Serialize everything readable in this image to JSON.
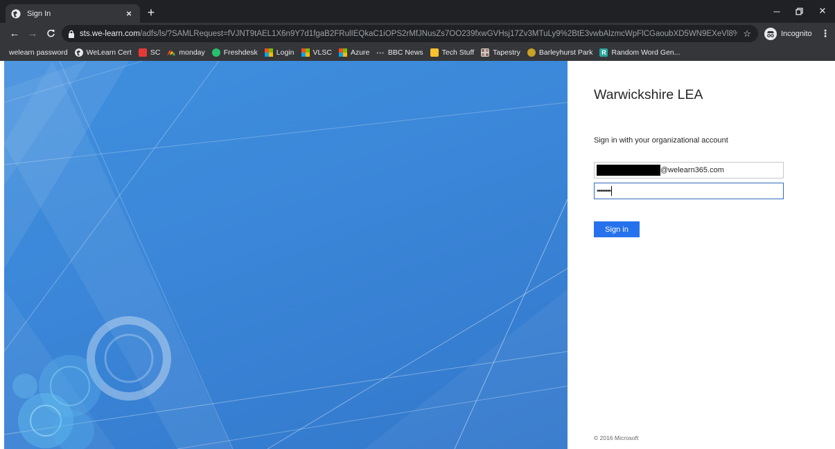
{
  "browser": {
    "tab_title": "Sign In",
    "url_host": "sts.we-learn.com",
    "url_path": "/adfs/ls/?SAMLRequest=fVJNT9tAEL1X6n9Y7d1fgaB2FRulIEQkaC1iOPS2rMfJNusZs7OO239fxwGVHsj17Zv3MTuLy9%2BtE3vwbAlzmcWpFlCGaoubXD5WN9EXeVl8%2FrRg3bpOLfu...",
    "incognito_label": "Incognito"
  },
  "bookmarks": [
    {
      "label": "welearn password",
      "icon": "none"
    },
    {
      "label": "WeLearn Cert",
      "icon": "globe-icon"
    },
    {
      "label": "SC",
      "icon": "red-folder-icon"
    },
    {
      "label": "monday",
      "icon": "monday-icon"
    },
    {
      "label": "Freshdesk",
      "icon": "freshdesk-icon"
    },
    {
      "label": "Login",
      "icon": "microsoft-icon"
    },
    {
      "label": "VLSC",
      "icon": "microsoft-icon"
    },
    {
      "label": "Azure",
      "icon": "microsoft-icon"
    },
    {
      "label": "BBC News",
      "icon": "bbc-icon"
    },
    {
      "label": "Tech Stuff",
      "icon": "yellow-folder-icon"
    },
    {
      "label": "Tapestry",
      "icon": "tapestry-icon"
    },
    {
      "label": "Barleyhurst Park",
      "icon": "barleyhurst-icon"
    },
    {
      "label": "Random Word Gen...",
      "icon": "random-word-icon"
    }
  ],
  "login": {
    "org_name": "Warwickshire LEA",
    "prompt": "Sign in with your organizational account",
    "username_suffix": "@welearn365.com",
    "password_mask": "••••••••",
    "signin_label": "Sign in",
    "copyright": "© 2016 Microsoft"
  },
  "colors": {
    "accent": "#2672ec",
    "illustration_blue": "#3b86d8"
  }
}
